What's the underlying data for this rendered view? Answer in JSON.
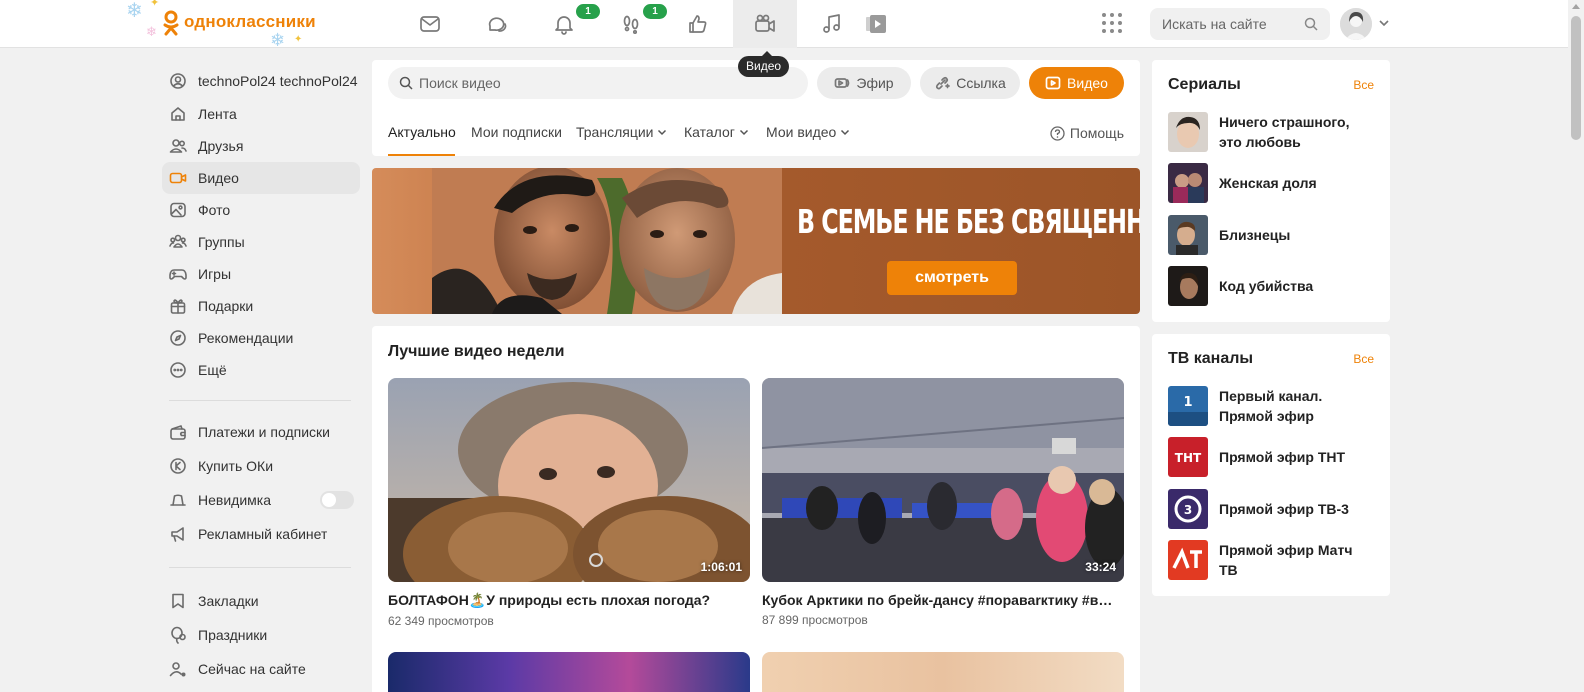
{
  "header": {
    "logo_text": "одноклассники",
    "tooltip": "Видео",
    "badges": {
      "notifications": "1",
      "guests": "1"
    },
    "search_placeholder": "Искать на сайте",
    "icons": [
      "mail-icon",
      "chat-icon",
      "bell-icon",
      "footprints-icon",
      "thumbs-up-icon",
      "video-camera-icon",
      "music-note-icon",
      "play-icon"
    ]
  },
  "sidebar": {
    "items": [
      {
        "label": "technoPol24 technoPol24",
        "icon": "user-icon"
      },
      {
        "label": "Лента",
        "icon": "home-icon"
      },
      {
        "label": "Друзья",
        "icon": "friends-icon"
      },
      {
        "label": "Видео",
        "icon": "video-icon",
        "active": true
      },
      {
        "label": "Фото",
        "icon": "photo-icon"
      },
      {
        "label": "Группы",
        "icon": "groups-icon"
      },
      {
        "label": "Игры",
        "icon": "gamepad-icon"
      },
      {
        "label": "Подарки",
        "icon": "gift-icon"
      },
      {
        "label": "Рекомендации",
        "icon": "compass-icon"
      },
      {
        "label": "Ещё",
        "icon": "more-icon"
      }
    ],
    "items2": [
      {
        "label": "Платежи и подписки",
        "icon": "wallet-icon"
      },
      {
        "label": "Купить ОКи",
        "icon": "coin-icon"
      },
      {
        "label": "Невидимка",
        "icon": "hat-icon",
        "toggle": false
      },
      {
        "label": "Рекламный кабинет",
        "icon": "megaphone-icon"
      }
    ],
    "items3": [
      {
        "label": "Закладки",
        "icon": "bookmark-icon"
      },
      {
        "label": "Праздники",
        "icon": "balloon-icon"
      },
      {
        "label": "Сейчас на сайте",
        "icon": "online-users-icon"
      }
    ]
  },
  "video": {
    "search_placeholder": "Поиск видео",
    "buttons": {
      "live": "Эфир",
      "link": "Ссылка",
      "upload": "Видео"
    },
    "tabs": [
      "Актуально",
      "Мои подписки",
      "Трансляции",
      "Каталог",
      "Мои видео"
    ],
    "help": "Помощь",
    "banner": {
      "title": "В СЕМЬЕ НЕ БЕЗ СВЯЩЕННИКА",
      "cta": "смотреть"
    },
    "best_title": "Лучшие видео недели",
    "cards": [
      {
        "title": "БОЛТАФОН🏝️У природы есть плохая погода?",
        "views": "62 349 просмотров",
        "duration": "1:06:01"
      },
      {
        "title": "Кубок Арктики по брейк-дансу #поравarктику #вы…",
        "views": "87 899 просмотров",
        "duration": "33:24"
      }
    ]
  },
  "right": {
    "series": {
      "title": "Сериалы",
      "all": "Все",
      "items": [
        "Ничего страшного, это любовь",
        "Женская доля",
        "Близнецы",
        "Код убийства"
      ]
    },
    "tv": {
      "title": "ТВ каналы",
      "all": "Все",
      "items": [
        "Первый канал. Прямой эфир",
        "Прямой эфир ТНТ",
        "Прямой эфир ТВ-3",
        "Прямой эфир Матч ТВ"
      ]
    }
  },
  "colors": {
    "accent": "#ee8208",
    "badge": "#27a14b"
  }
}
